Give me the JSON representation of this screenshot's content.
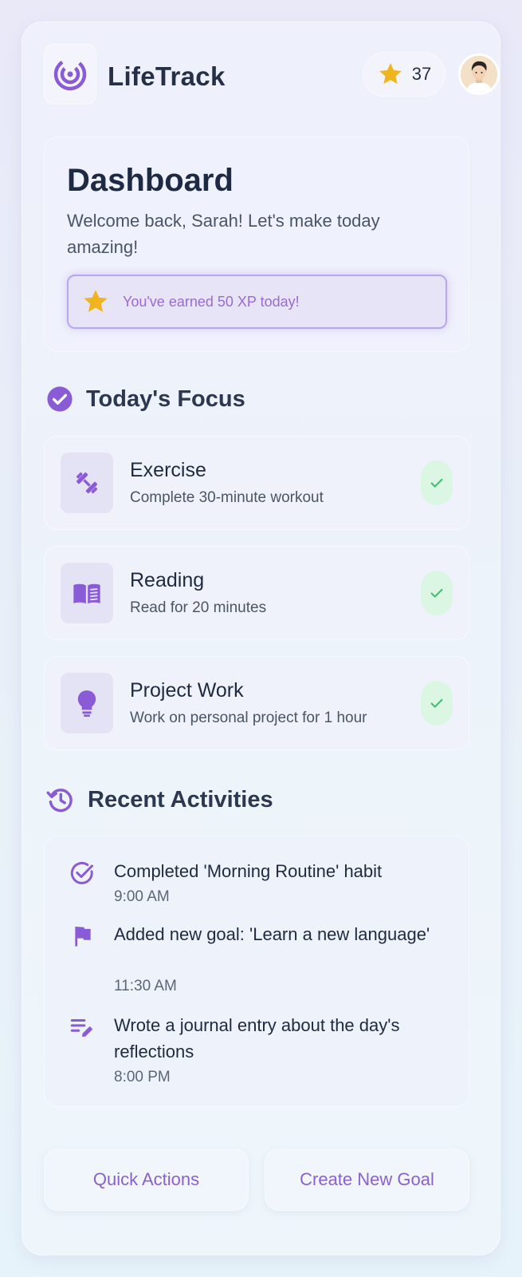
{
  "app": {
    "title": "LifeTrack",
    "xp_points": "37"
  },
  "dashboard": {
    "title": "Dashboard",
    "welcome": "Welcome back, Sarah! Let's make today amazing!",
    "xp_banner": "You've earned 50 XP today!"
  },
  "focus": {
    "title": "Today's Focus",
    "tasks": [
      {
        "title": "Exercise",
        "description": "Complete 30-minute workout",
        "icon": "dumbbell-icon",
        "done": true
      },
      {
        "title": "Reading",
        "description": "Read for 20 minutes",
        "icon": "book-icon",
        "done": true
      },
      {
        "title": "Project Work",
        "description": "Work on personal project for 1 hour",
        "icon": "lightbulb-icon",
        "done": true
      }
    ]
  },
  "activities": {
    "title": "Recent Activities",
    "items": [
      {
        "text": "Completed 'Morning Routine' habit",
        "time": "9:00 AM",
        "icon": "check-circle-icon"
      },
      {
        "text": "Added new goal: 'Learn a new language'",
        "time": "11:30 AM",
        "icon": "flag-icon"
      },
      {
        "text": "Wrote a journal entry about the day's reflections",
        "time": "8:00 PM",
        "icon": "edit-note-icon"
      }
    ]
  },
  "actions": {
    "quick": "Quick Actions",
    "create": "Create New Goal"
  },
  "colors": {
    "accent": "#8a61d2",
    "star": "#f0b51e",
    "success": "#34c26d"
  }
}
